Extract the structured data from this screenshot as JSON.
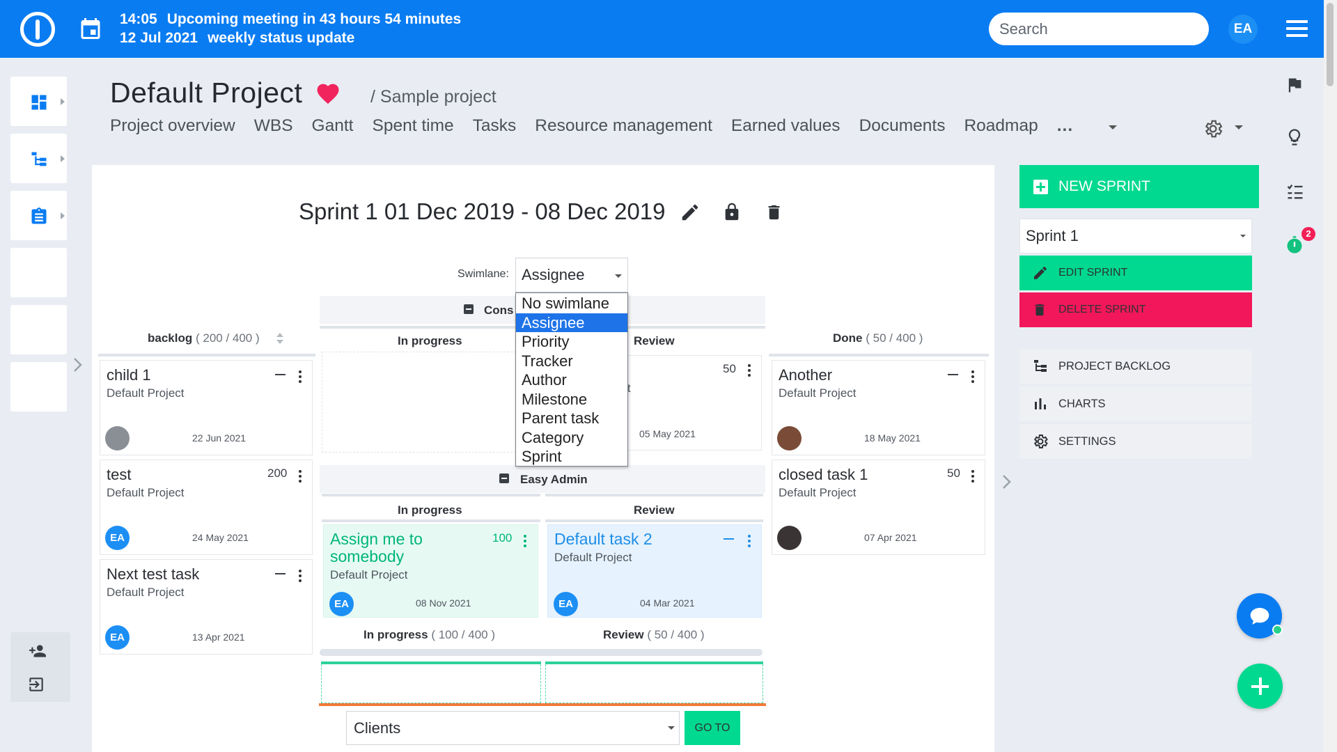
{
  "topbar": {
    "meeting_time": "14:05",
    "meeting_text": "Upcoming meeting in 43 hours 54 minutes",
    "meeting_date": "12 Jul 2021",
    "meeting_name": "weekly status update",
    "search_placeholder": "Search",
    "user_initials": "EA"
  },
  "project": {
    "title": "Default Project",
    "breadcrumb": "/ Sample project",
    "nav": [
      "Project overview",
      "WBS",
      "Gantt",
      "Spent time",
      "Tasks",
      "Resource management",
      "Earned values",
      "Documents",
      "Roadmap",
      "..."
    ]
  },
  "sprint": {
    "title": "Sprint 1 01 Dec 2019 - 08 Dec 2019",
    "swimlane_label": "Swimlane:",
    "swimlane_value": "Assignee",
    "swimlane_options": [
      "No swimlane",
      "Assignee",
      "Priority",
      "Tracker",
      "Author",
      "Milestone",
      "Parent task",
      "Category",
      "Sprint"
    ],
    "swimlane_selected_index": 1
  },
  "columns": {
    "backlog": {
      "name": "backlog",
      "count": "( 200 / 400 )"
    },
    "done": {
      "name": "Done",
      "count": "( 50 / 400 )"
    },
    "in_progress": "In progress",
    "review": "Review",
    "in_progress_total": {
      "name": "In progress",
      "count": "( 100 / 400 )"
    },
    "review_total": {
      "name": "Review",
      "count": "( 50 / 400 )"
    }
  },
  "groups": {
    "first": "Cons",
    "second": "Easy Admin"
  },
  "backlog_cards": [
    {
      "title": "child 1",
      "points": "—",
      "project": "Default Project",
      "date": "22 Jun 2021",
      "avatar": "photo"
    },
    {
      "title": "test",
      "points": "200",
      "project": "Default Project",
      "date": "24 May 2021",
      "avatar": "EA"
    },
    {
      "title": "Next test task",
      "points": "—",
      "project": "Default Project",
      "date": "13 Apr 2021",
      "avatar": "EA"
    }
  ],
  "review_card_1": {
    "points": "50",
    "partial": "t",
    "date": "05 May 2021"
  },
  "ea_cards": [
    {
      "title": "Assign me to somebody",
      "points": "100",
      "project": "Default Project",
      "date": "08 Nov 2021",
      "avatar": "EA"
    },
    {
      "title": "Default task 2",
      "points": "—",
      "project": "Default Project",
      "date": "04 Mar 2021",
      "avatar": "EA"
    }
  ],
  "done_cards": [
    {
      "title": "Another",
      "points": "—",
      "project": "Default Project",
      "date": "18 May 2021",
      "avatar": "photo"
    },
    {
      "title": "closed task 1",
      "points": "50",
      "project": "Default Project",
      "date": "07 Apr 2021",
      "avatar": "photo"
    }
  ],
  "bottom": {
    "clients": "Clients",
    "goto": "GO TO"
  },
  "sidebar": {
    "new_sprint": "NEW SPRINT",
    "sprint_select": "Sprint 1",
    "edit_sprint": "EDIT SPRINT",
    "delete_sprint": "DELETE SPRINT",
    "project_backlog": "PROJECT BACKLOG",
    "charts": "CHARTS",
    "settings": "SETTINGS"
  },
  "timer_badge": "2",
  "colors": {
    "primary": "#0a7cf2",
    "accent_green": "#00d98f",
    "danger": "#f21f55",
    "heart": "#f2245d"
  }
}
